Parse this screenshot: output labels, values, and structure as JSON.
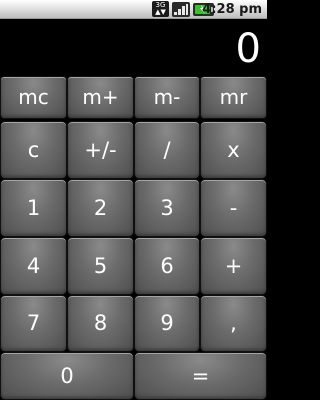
{
  "status_bar": {
    "network": "3G",
    "time": "4:28 pm",
    "icons": [
      "3g-network-icon",
      "signal-strength-icon",
      "battery-charging-icon"
    ]
  },
  "display": {
    "value": "0"
  },
  "keys": {
    "mc": "mc",
    "m_plus": "m+",
    "m_minus": "m-",
    "mr": "mr",
    "clear": "c",
    "plus_minus": "+/-",
    "divide": "/",
    "multiply": "x",
    "one": "1",
    "two": "2",
    "three": "3",
    "subtract": "-",
    "four": "4",
    "five": "5",
    "six": "6",
    "add": "+",
    "seven": "7",
    "eight": "8",
    "nine": "9",
    "comma": ",",
    "zero": "0",
    "equals": "="
  },
  "colors": {
    "background": "#000000",
    "key": "#6b6b6b",
    "key_text": "#ffffff",
    "display_text": "#ffffff"
  }
}
